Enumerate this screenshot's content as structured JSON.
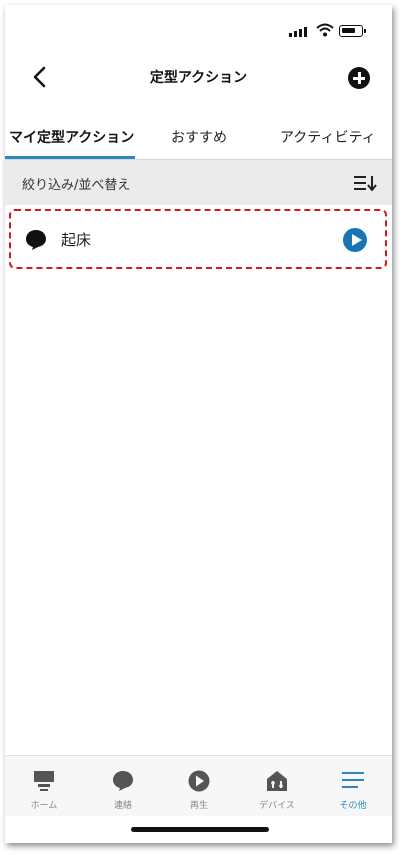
{
  "status_bar": {
    "icons": [
      "cellular-signal-icon",
      "wifi-icon",
      "battery-icon"
    ]
  },
  "header": {
    "title": "定型アクション",
    "back_icon": "chevron-left-icon",
    "add_icon": "plus-circle-icon"
  },
  "tabs": [
    {
      "label": "マイ定型アクション",
      "active": true
    },
    {
      "label": "おすすめ",
      "active": false
    },
    {
      "label": "アクティビティ",
      "active": false
    }
  ],
  "filter": {
    "label": "絞り込み/並べ替え",
    "icon": "sort-list-icon"
  },
  "routines": [
    {
      "label": "起床",
      "icon": "speech-bubble-icon",
      "action_icon": "play-icon"
    }
  ],
  "bottom_nav": [
    {
      "label": "ホーム",
      "icon": "home-device-icon",
      "active": false
    },
    {
      "label": "連絡",
      "icon": "chat-bubble-icon",
      "active": false
    },
    {
      "label": "再生",
      "icon": "play-circle-icon",
      "active": false
    },
    {
      "label": "デバイス",
      "icon": "smart-home-icon",
      "active": false
    },
    {
      "label": "その他",
      "icon": "menu-lines-icon",
      "active": true
    }
  ],
  "colors": {
    "accent": "#2e87c3",
    "play": "#1a73b4",
    "highlight_border": "#d21a1a",
    "filter_bg": "#ebebeb"
  }
}
